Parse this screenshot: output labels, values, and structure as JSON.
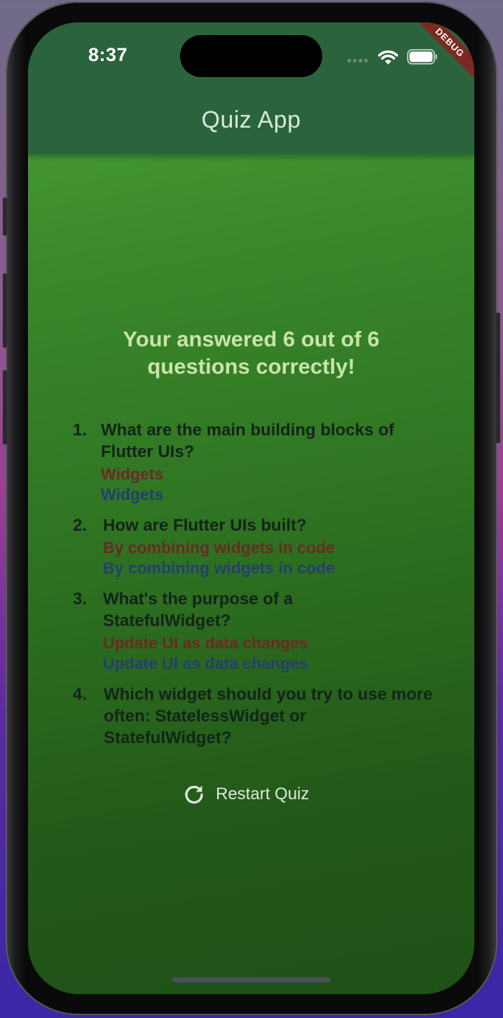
{
  "status_bar": {
    "time": "8:37"
  },
  "debug_banner": "DEBUG",
  "app_bar": {
    "title": "Quiz App"
  },
  "results": {
    "summary": "Your answered 6 out of 6 questions correctly!",
    "items": [
      {
        "number": "1.",
        "question": "What are the main building blocks of Flutter UIs?",
        "user_answer": "Widgets",
        "correct_answer": "Widgets"
      },
      {
        "number": "2.",
        "question": "How are Flutter UIs built?",
        "user_answer": "By combining widgets in code",
        "correct_answer": "By combining widgets in code"
      },
      {
        "number": "3.",
        "question": "What's the purpose of a StatefulWidget?",
        "user_answer": "Update UI as data changes",
        "correct_answer": "Update UI as data changes"
      },
      {
        "number": "4.",
        "question": "Which widget should you try to use more often: StatelessWidget or StatefulWidget?"
      }
    ]
  },
  "restart_button": {
    "label": "Restart Quiz",
    "icon": "refresh-icon"
  },
  "colors": {
    "app_bar": "#2b643c",
    "background_top": "#4ea338",
    "background_bottom": "#1f5117",
    "user_answer": "#6a2a22",
    "correct_answer": "#243f6e",
    "summary_text": "#c9e4a8"
  }
}
